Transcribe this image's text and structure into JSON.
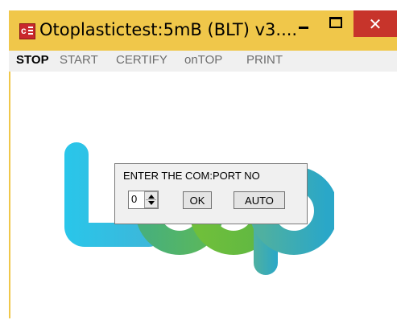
{
  "window": {
    "title": "Otoplastictest:5mB (BLT) v3....",
    "frame_color": "#f0c74a",
    "close_glyph": "✕"
  },
  "menu": {
    "items": [
      "STOP",
      "START",
      "CERTIFY",
      "onTOP",
      "PRINT"
    ],
    "active": "STOP"
  },
  "dialog": {
    "label": "ENTER THE COM:PORT NO",
    "port_value": "0",
    "ok_label": "OK",
    "auto_label": "AUTO"
  },
  "icons": {
    "app": "app-icon",
    "minimize": "minimize-icon",
    "maximize": "maximize-icon",
    "close": "close-icon",
    "spinner": "spin-arrows-icon"
  }
}
